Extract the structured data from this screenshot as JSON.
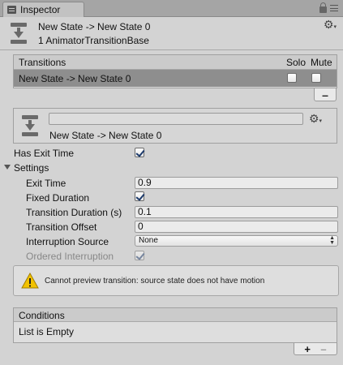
{
  "window": {
    "tab_label": "Inspector"
  },
  "header": {
    "title": "New State -> New State 0",
    "subtitle": "1 AnimatorTransitionBase"
  },
  "transitions_list": {
    "header": "Transitions",
    "col_solo": "Solo",
    "col_mute": "Mute",
    "rows": [
      {
        "label": "New State -> New State 0",
        "solo": false,
        "mute": false,
        "selected": true
      }
    ],
    "remove_label": "–"
  },
  "transition_detail": {
    "name_value": "",
    "label": "New State -> New State 0"
  },
  "properties": {
    "has_exit_time_label": "Has Exit Time",
    "has_exit_time": true,
    "settings_label": "Settings",
    "exit_time_label": "Exit Time",
    "exit_time_value": "0.9",
    "fixed_duration_label": "Fixed Duration",
    "fixed_duration": true,
    "transition_duration_label": "Transition Duration (s)",
    "transition_duration_value": "0.1",
    "transition_offset_label": "Transition Offset",
    "transition_offset_value": "0",
    "interruption_source_label": "Interruption Source",
    "interruption_source_value": "None",
    "ordered_interruption_label": "Ordered Interruption",
    "ordered_interruption": true
  },
  "warning": {
    "icon": "warning-icon",
    "text": "Cannot preview transition: source state does not have motion"
  },
  "conditions": {
    "header": "Conditions",
    "empty_text": "List is Empty",
    "add_label": "+",
    "remove_label": "–"
  },
  "colors": {
    "selected_row": "#8e8e8e",
    "panel_bg": "#d3d3d3",
    "warning_yellow": "#f2c200"
  }
}
